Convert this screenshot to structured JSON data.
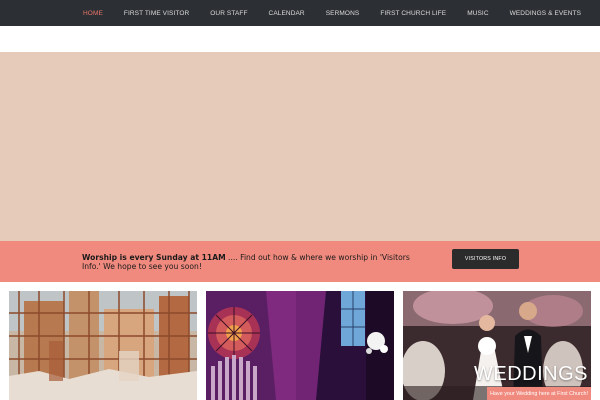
{
  "nav": {
    "items": [
      {
        "label": "HOME",
        "active": true
      },
      {
        "label": "FIRST TIME VISITOR",
        "active": false
      },
      {
        "label": "OUR STAFF",
        "active": false
      },
      {
        "label": "CALENDAR",
        "active": false
      },
      {
        "label": "SERMONS",
        "active": false
      },
      {
        "label": "FIRST CHURCH LIFE",
        "active": false
      },
      {
        "label": "MUSIC",
        "active": false
      },
      {
        "label": "WEDDINGS & EVENTS",
        "active": false
      }
    ]
  },
  "banner": {
    "bold_text": "Worship is every Sunday at 11AM",
    "rest_text": " .... Find out how & where we worship in 'Visitors Info.' We hope to see you soon!",
    "button_label": "VISITORS INFO"
  },
  "gallery": {
    "tiles": [
      {
        "name": "construction-artwork"
      },
      {
        "name": "stained-glass-organ"
      },
      {
        "name": "wedding",
        "title": "WEDDINGS",
        "subtitle": "Have your Wedding here at First Church!"
      }
    ]
  },
  "colors": {
    "nav_bg": "#2c2f33",
    "nav_active": "#e8756a",
    "hero_bg": "#e6cbbb",
    "banner_bg": "#f08a7e",
    "button_bg": "#2b2b2b"
  }
}
